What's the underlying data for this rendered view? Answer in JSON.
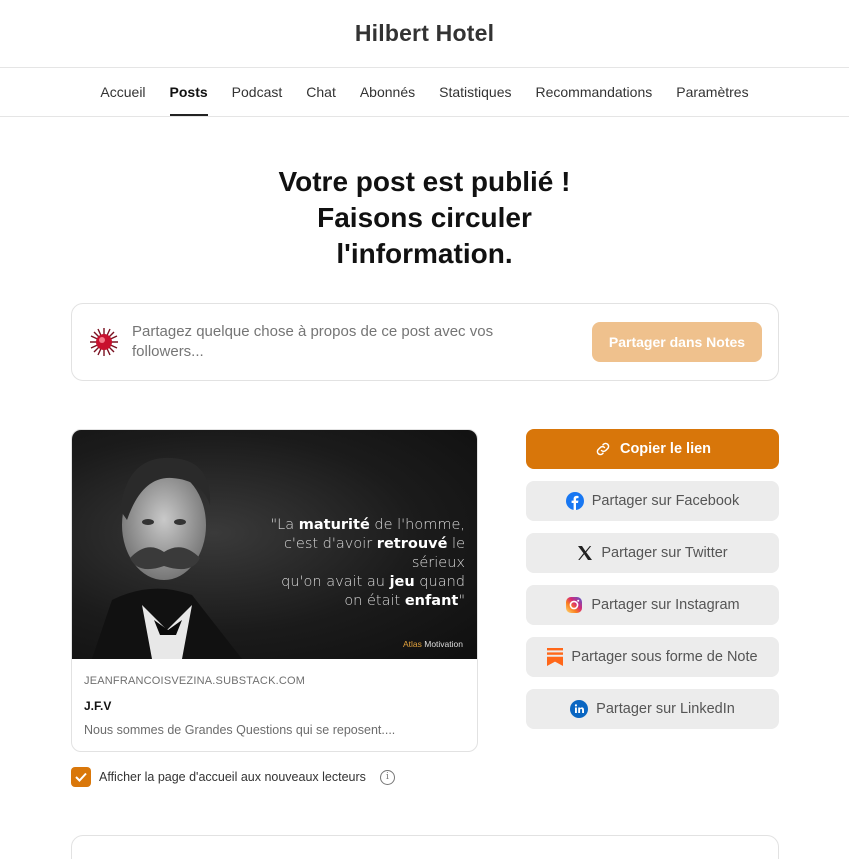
{
  "header": {
    "title": "Hilbert Hotel"
  },
  "nav": {
    "items": [
      {
        "label": "Accueil",
        "active": false
      },
      {
        "label": "Posts",
        "active": true
      },
      {
        "label": "Podcast",
        "active": false
      },
      {
        "label": "Chat",
        "active": false
      },
      {
        "label": "Abonnés",
        "active": false
      },
      {
        "label": "Statistiques",
        "active": false
      },
      {
        "label": "Recommandations",
        "active": false
      },
      {
        "label": "Paramètres",
        "active": false
      }
    ]
  },
  "main": {
    "headline": [
      "Votre post est publié !",
      "Faisons circuler",
      "l'information."
    ],
    "share_box": {
      "placeholder": "Partagez quelque chose à propos de ce post avec vos followers...",
      "button_label": "Partager dans Notes",
      "avatar_icon": "red-burst-avatar-icon"
    },
    "preview_card": {
      "image_quote_parts": {
        "p1": "\"La ",
        "b1": "maturité",
        "p2": " de l'homme,",
        "p3": "c'est d'avoir ",
        "b2": "retrouvé",
        "p4": " le sérieux",
        "p5": "qu'on avait au ",
        "b3": "jeu",
        "p6": " quand",
        "p7": "on était ",
        "b4": "enfant",
        "p8": "\""
      },
      "image_brand": {
        "part1": "Atlas",
        "part2": " Motivation"
      },
      "domain": "JEANFRANCOISVEZINA.SUBSTACK.COM",
      "title": "J.F.V",
      "description": "Nous sommes de Grandes Questions qui se reposent...."
    },
    "checkbox": {
      "label": "Afficher la page d'accueil aux nouveaux lecteurs",
      "checked": true,
      "info_glyph": "i"
    },
    "actions": {
      "copy_link": "Copier le lien",
      "facebook": "Partager sur Facebook",
      "twitter": "Partager sur Twitter",
      "instagram": "Partager sur Instagram",
      "note": "Partager sous forme de Note",
      "linkedin": "Partager sur LinkedIn"
    }
  },
  "colors": {
    "accent": "#d8760a",
    "accent_light": "#efc18d",
    "facebook": "#1877f2",
    "linkedin": "#0a66c2",
    "note": "#ff6719"
  }
}
